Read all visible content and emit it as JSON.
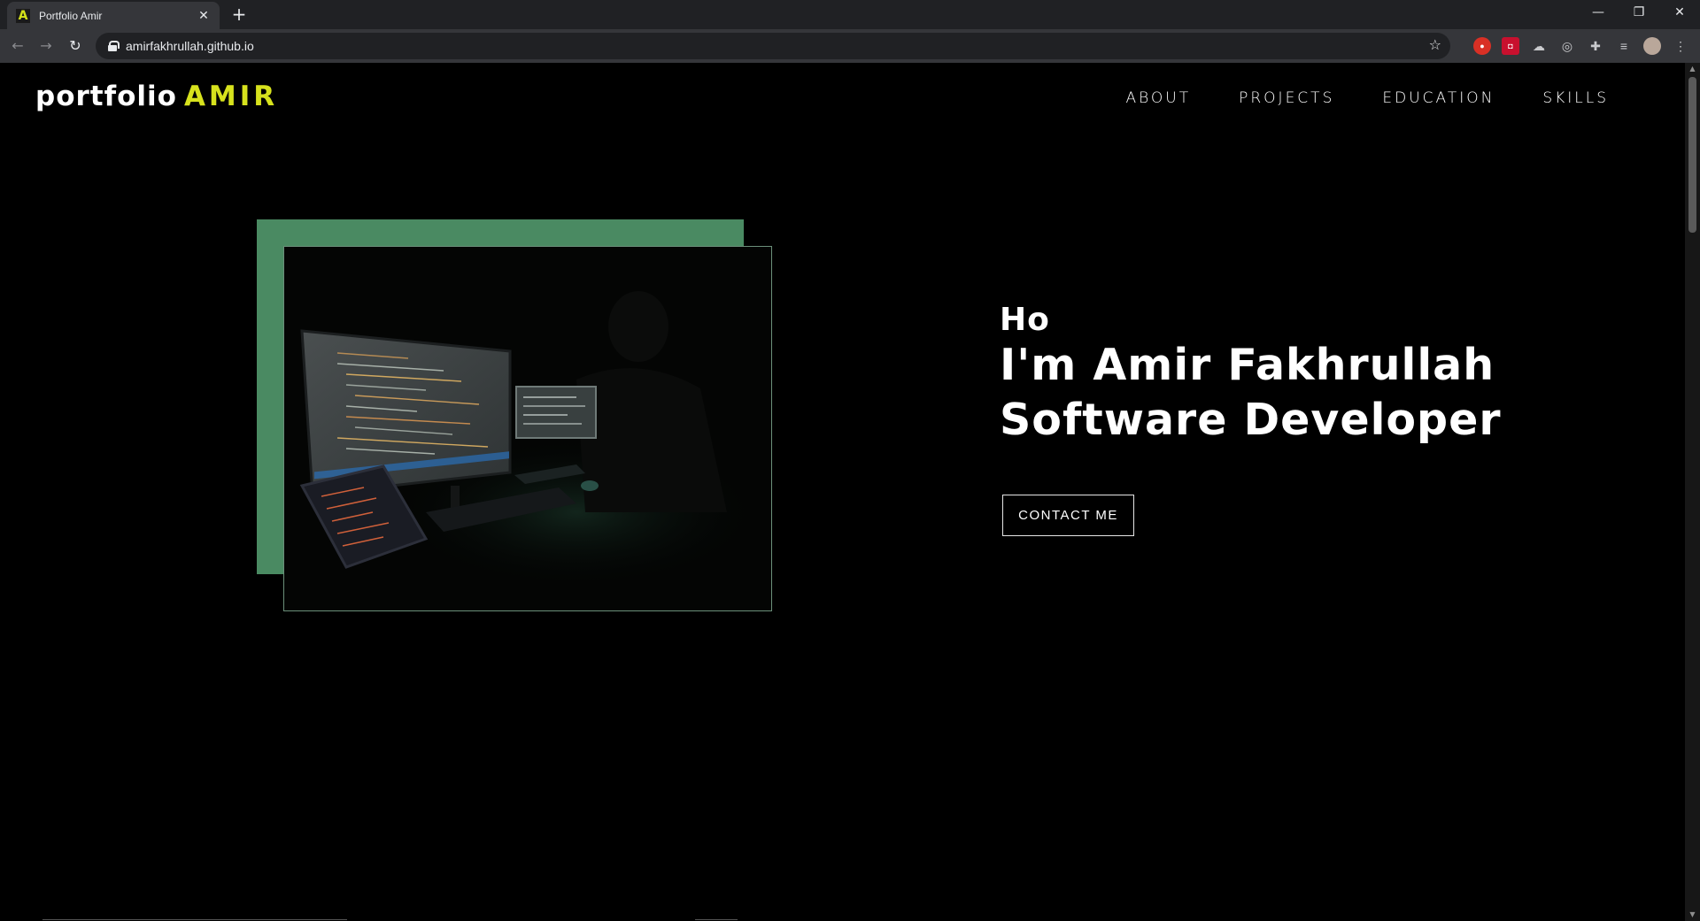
{
  "browser": {
    "tab_title": "Portfolio Amir",
    "tab_favicon": "A",
    "url": "amirfakhrullah.github.io",
    "new_tab_glyph": "+",
    "close_glyph": "✕"
  },
  "header": {
    "logo_main": "portfolio",
    "logo_accent": "AMIR",
    "nav": [
      "ABOUT",
      "PROJECTS",
      "EDUCATION",
      "SKILLS"
    ]
  },
  "hero": {
    "greeting": "Ho",
    "name_line": "I'm Amir Fakhrullah",
    "role_line": "Software Developer",
    "cta_label": "CONTACT ME"
  },
  "colors": {
    "accent": "#d7e21d",
    "frame_green": "#4a8a62",
    "background": "#000000"
  },
  "icons": [
    "back-arrow-icon",
    "forward-arrow-icon",
    "reload-icon",
    "lock-icon",
    "star-icon",
    "extensions-icon",
    "menu-icon"
  ]
}
